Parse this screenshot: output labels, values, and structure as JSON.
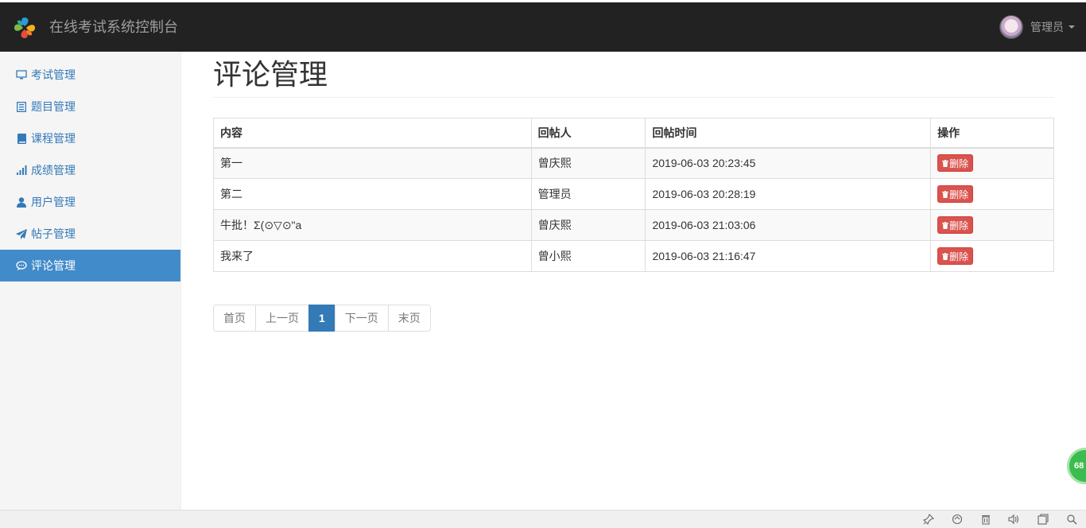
{
  "app": {
    "title": "在线考试系统控制台",
    "user_name": "管理员"
  },
  "sidebar": {
    "items": [
      {
        "label": "考试管理",
        "icon": "monitor-icon"
      },
      {
        "label": "题目管理",
        "icon": "list-icon"
      },
      {
        "label": "课程管理",
        "icon": "book-icon"
      },
      {
        "label": "成绩管理",
        "icon": "signal-icon"
      },
      {
        "label": "用户管理",
        "icon": "user-icon"
      },
      {
        "label": "帖子管理",
        "icon": "send-icon"
      },
      {
        "label": "评论管理",
        "icon": "comment-icon",
        "active": true
      }
    ]
  },
  "main": {
    "title": "评论管理",
    "table": {
      "headers": [
        "内容",
        "回帖人",
        "回帖时间",
        "操作"
      ],
      "rows": [
        {
          "content": "第一",
          "author": "曾庆熙",
          "time": "2019-06-03 20:23:45",
          "action": "删除"
        },
        {
          "content": "第二",
          "author": "管理员",
          "time": "2019-06-03 20:28:19",
          "action": "删除"
        },
        {
          "content": "牛批！Σ(⊙▽⊙\"a",
          "author": "曾庆熙",
          "time": "2019-06-03 21:03:06",
          "action": "删除"
        },
        {
          "content": "我来了",
          "author": "曾小熙",
          "time": "2019-06-03 21:16:47",
          "action": "删除"
        }
      ]
    },
    "pagination": {
      "first": "首页",
      "prev": "上一页",
      "current": "1",
      "next": "下一页",
      "last": "末页"
    }
  },
  "float_badge": "68",
  "colors": {
    "accent": "#428bca",
    "danger": "#d9534f",
    "topbar": "#222222"
  }
}
